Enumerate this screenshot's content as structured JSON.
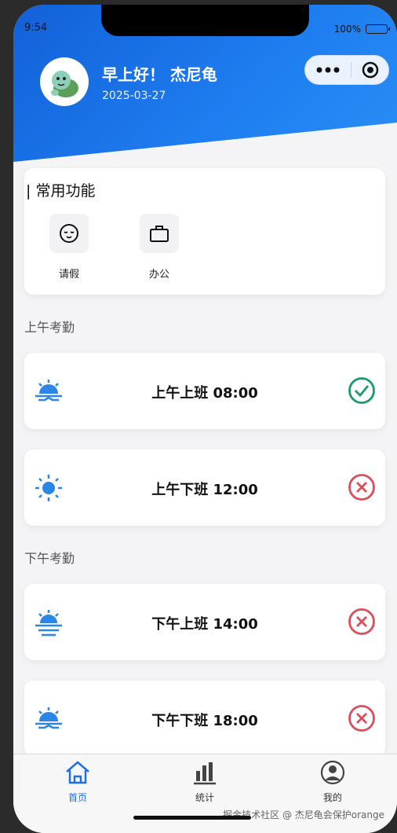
{
  "status_bar": {
    "time": "9:54",
    "battery": "100%"
  },
  "header": {
    "greeting": "早上好！ 杰尼龟",
    "date": "2025-03-27"
  },
  "common": {
    "title": "| 常用功能",
    "items": [
      {
        "label": "请假",
        "icon": "mood-face-icon"
      },
      {
        "label": "办公",
        "icon": "briefcase-icon"
      }
    ]
  },
  "morning": {
    "label": "上午考勤",
    "cards": [
      {
        "title": "上午上班 08:00",
        "icon": "sunrise-icon",
        "status": "checked"
      },
      {
        "title": "上午下班 12:00",
        "icon": "sun-icon",
        "status": "missed"
      }
    ]
  },
  "afternoon": {
    "label": "下午考勤",
    "cards": [
      {
        "title": "下午上班 14:00",
        "icon": "sunset-icon",
        "status": "missed"
      },
      {
        "title": "下午下班 18:00",
        "icon": "sunrise-icon",
        "status": "missed"
      }
    ]
  },
  "tabbar": [
    {
      "label": "首页",
      "icon": "home-icon",
      "active": true
    },
    {
      "label": "统计",
      "icon": "bar-chart-icon",
      "active": false
    },
    {
      "label": "我的",
      "icon": "user-icon",
      "active": false
    }
  ],
  "watermark": "掘金技术社区 @ 杰尼龟会保护orange",
  "colors": {
    "accent": "#1e6fe6",
    "success": "#1a9a6c",
    "danger": "#d9505a"
  }
}
